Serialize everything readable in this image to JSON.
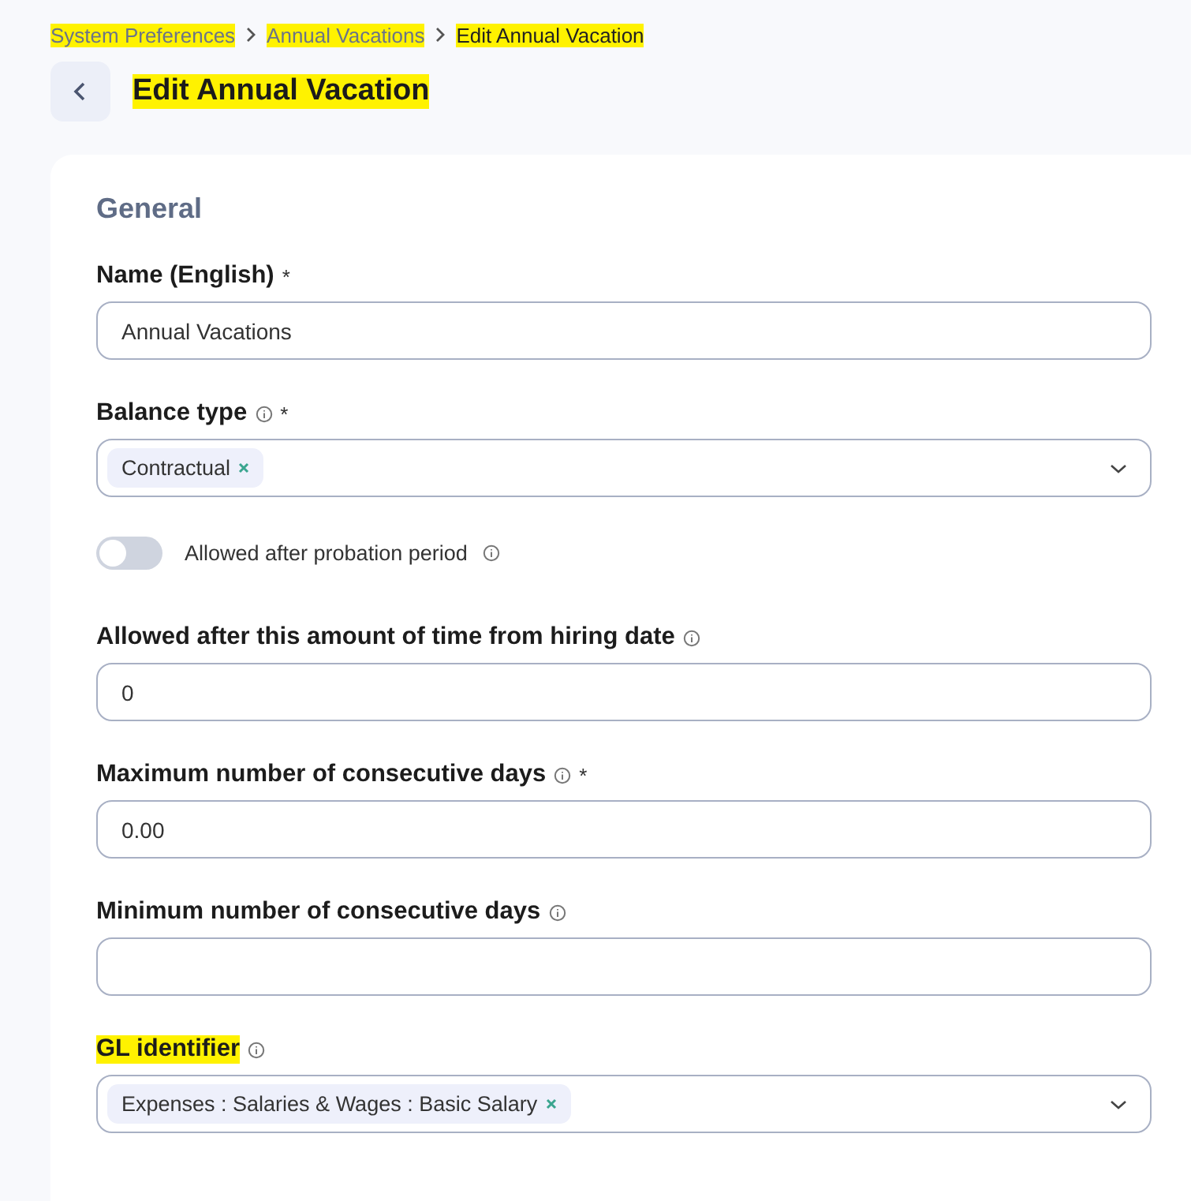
{
  "breadcrumb": [
    {
      "label": "System Preferences",
      "highlighted": true
    },
    {
      "label": "Annual Vacations",
      "highlighted": true
    },
    {
      "label": "Edit Annual Vacation",
      "highlighted": true
    }
  ],
  "title": {
    "text": "Edit Annual Vacation",
    "highlighted": true
  },
  "section": {
    "title": "General"
  },
  "fields": [
    {
      "kind": "text",
      "label": "Name (English)",
      "info": false,
      "required_mark": "*",
      "highlighted": false,
      "value": "Annual Vacations"
    },
    {
      "kind": "select",
      "label": "Balance type",
      "info": true,
      "required_mark": "*",
      "highlighted": false,
      "tags": [
        "Contractual"
      ]
    },
    {
      "kind": "toggle",
      "label": "Allowed after probation period",
      "info": true,
      "on": false
    },
    {
      "kind": "text",
      "label": "Allowed after this amount of time from hiring date",
      "info": true,
      "highlighted": false,
      "value": "0"
    },
    {
      "kind": "text",
      "label": "Maximum number of consecutive days",
      "info": true,
      "required_mark": "*",
      "highlighted": false,
      "value": "0.00"
    },
    {
      "kind": "text",
      "label": "Minimum number of consecutive days",
      "info": true,
      "highlighted": false
    },
    {
      "kind": "select",
      "label": "GL identifier",
      "info": true,
      "highlighted": true,
      "tags": [
        "Expenses : Salaries & Wages : Basic Salary"
      ]
    }
  ]
}
